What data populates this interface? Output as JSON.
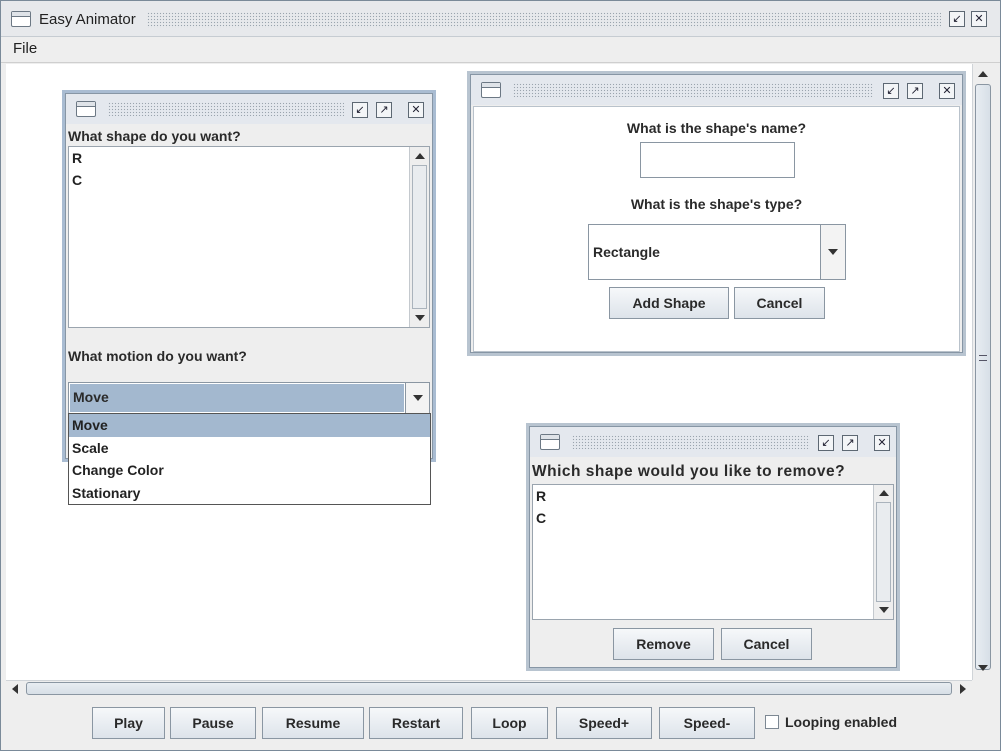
{
  "app": {
    "title": "Easy Animator"
  },
  "menu": {
    "file": "File"
  },
  "shape_motion_dialog": {
    "shape_prompt": "What shape do you want?",
    "shapes": [
      "R",
      "C"
    ],
    "motion_prompt": "What motion do you want?",
    "selected_motion": "Move",
    "motion_options": [
      "Move",
      "Scale",
      "Change Color",
      "Stationary"
    ]
  },
  "add_shape_dialog": {
    "name_prompt": "What is the shape's name?",
    "name_value": "",
    "type_prompt": "What is the shape's type?",
    "type_value": "Rectangle",
    "add_label": "Add Shape",
    "cancel_label": "Cancel"
  },
  "remove_shape_dialog": {
    "prompt": "Which shape would you like to remove?",
    "shapes": [
      "R",
      "C"
    ],
    "remove_label": "Remove",
    "cancel_label": "Cancel"
  },
  "controls": {
    "play": "Play",
    "pause": "Pause",
    "resume": "Resume",
    "restart": "Restart",
    "loop": "Loop",
    "speed_up": "Speed+",
    "speed_down": "Speed-",
    "looping_label": "Looping enabled",
    "looping_checked": false
  },
  "colors": {
    "selection": "#a3b8cf",
    "frame_border": "#a9bcd2"
  }
}
